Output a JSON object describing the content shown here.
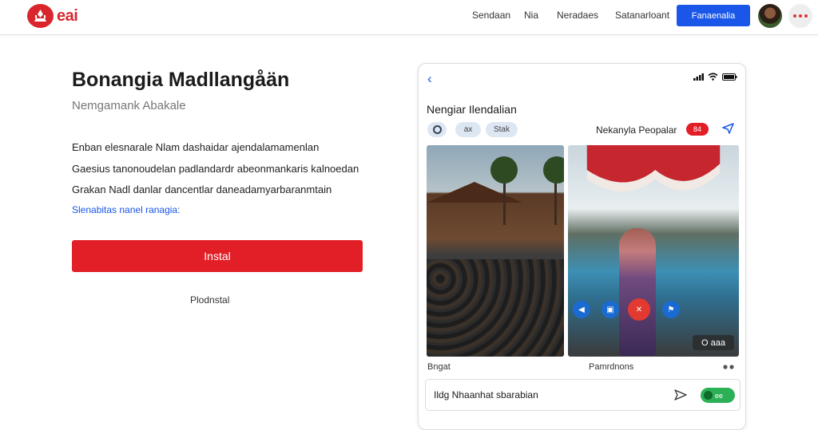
{
  "brand": {
    "name": "eai",
    "color": "#d9252c"
  },
  "nav": {
    "links": [
      "Sendaan",
      "Nia",
      "Neradaes",
      "Satanarloant"
    ],
    "cta_label": "Fanaenalia"
  },
  "hero": {
    "title": "Bonangia Madllangåän",
    "subtitle": "Nemgamank Abakale",
    "paragraph_lines": [
      "Enban elesnarale Nlam dashaidar ajendalamamenlan",
      "Gaesius tanonoudelan padlandardr abeonmankaris kalnoedan",
      "Grakan Nadl danlar dancentlar daneadamyarbaranmtain"
    ],
    "link_text": "Slenabitas nanel ranagia:",
    "install_label": "Instal",
    "secondary_label": "Plodnstal"
  },
  "preview": {
    "back_icon": "chevron-left-icon",
    "title": "Nengiar Ilendalian",
    "chips": [
      "",
      "ax",
      "Stak"
    ],
    "meta_label": "Nekanyla Peopalar",
    "live_badge": "84",
    "photo_time": "O aaa",
    "caption_left": "Bngat",
    "caption_center": "Pamrdnons",
    "comment_text": "Ildg Nhaanhat sbarabian",
    "comment_badge": "ee",
    "accent_blue": "#1a56e8",
    "accent_red": "#e21e26"
  }
}
